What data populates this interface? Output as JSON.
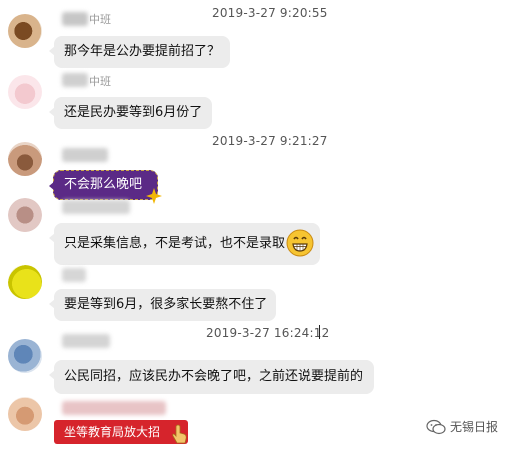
{
  "messages": [
    {
      "time": "2019-3-27 9:20:55",
      "name_fragment": "中班",
      "text": "那今年是公办要提前招了？"
    },
    {
      "name_fragment": "中班",
      "text": "还是民办要等到6月份了"
    },
    {
      "time": "2019-3-27 9:21:27",
      "text": "不会那么晚吧",
      "style": "purple"
    },
    {
      "text": "只是采集信息，不是考试，也不是录取",
      "emoji": "grinning-face-icon"
    },
    {
      "text": "要是等到6月，很多家长要熬不住了"
    },
    {
      "time": "2019-3-27 16:24:12",
      "text": "公民同招，应该民办不会晚了吧，之前还说要提前的"
    },
    {
      "text": "坐等教育局放大招",
      "style": "red"
    }
  ],
  "watermark": {
    "text": "无锡日报"
  },
  "colors": {
    "bubble_gray": "#ececec",
    "bubble_purple": "#5b2a86",
    "bubble_red": "#d6242c",
    "timestamp": "#555555"
  }
}
